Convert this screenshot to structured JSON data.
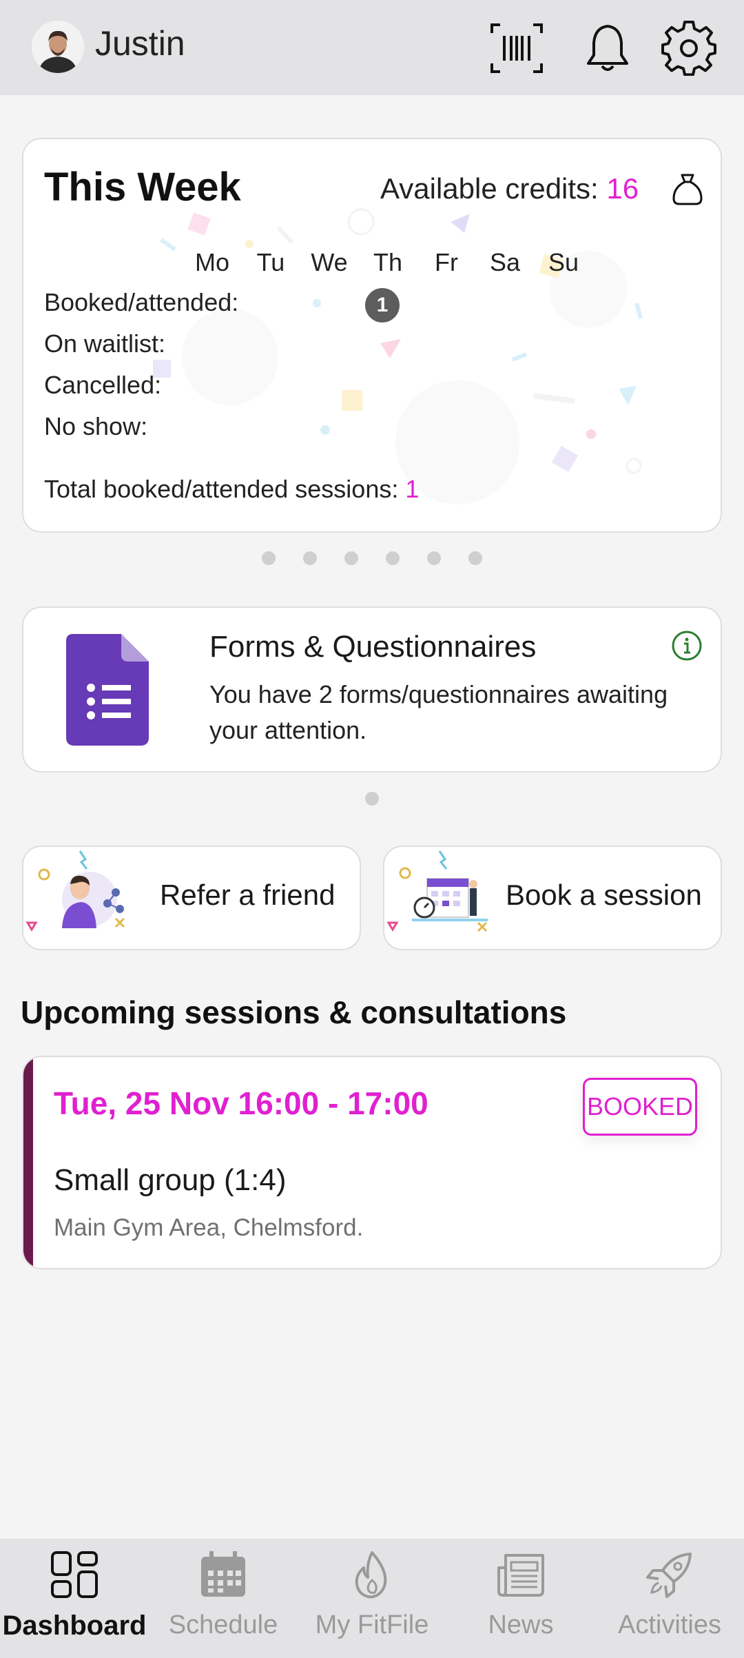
{
  "header": {
    "user_name": "Justin",
    "icons": [
      "barcode-icon",
      "bell-icon",
      "gear-icon"
    ]
  },
  "this_week": {
    "title": "This Week",
    "credits_label": "Available credits:",
    "credits_value": "16",
    "days": [
      "Mo",
      "Tu",
      "We",
      "Th",
      "Fr",
      "Sa",
      "Su"
    ],
    "rows": [
      "Booked/attended:",
      "On waitlist:",
      "Cancelled:",
      "No show:"
    ],
    "booked_tuesday_count": "1",
    "total_label": "Total booked/attended sessions:",
    "total_value": "1"
  },
  "carousel": {
    "pages": 6,
    "active": 0
  },
  "forms": {
    "title": "Forms & Questionnaires",
    "text": "You have 2 forms/questionnaires awaiting your attention."
  },
  "actions": {
    "refer_label": "Refer a friend",
    "book_label": "Book a session"
  },
  "upcoming": {
    "title": "Upcoming sessions & consultations",
    "session": {
      "time": "Tue, 25 Nov 16:00 - 17:00",
      "status": "BOOKED",
      "name": "Small group (1:4)",
      "location": "Main Gym Area, Chelmsford."
    }
  },
  "nav": {
    "items": [
      {
        "label": "Dashboard",
        "icon": "dashboard-icon",
        "active": true
      },
      {
        "label": "Schedule",
        "icon": "calendar-icon",
        "active": false
      },
      {
        "label": "My FitFile",
        "icon": "flame-icon",
        "active": false
      },
      {
        "label": "News",
        "icon": "newspaper-icon",
        "active": false
      },
      {
        "label": "Activities",
        "icon": "rocket-icon",
        "active": false
      }
    ]
  },
  "colors": {
    "accent": "#e020d0",
    "session_accent": "#6a1a4c",
    "forms_purple": "#673ab7",
    "bar_bg": "#e3e3e5"
  }
}
